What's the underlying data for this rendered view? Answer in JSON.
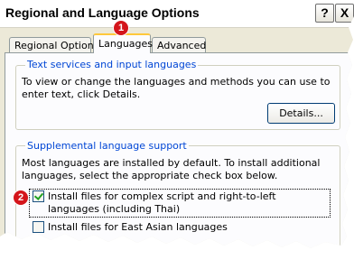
{
  "window": {
    "title": "Regional and Language Options",
    "help_button": "?",
    "close_button": "X"
  },
  "tabs": [
    {
      "label": "Regional Options",
      "selected": false
    },
    {
      "label": "Languages",
      "selected": true
    },
    {
      "label": "Advanced",
      "selected": false
    }
  ],
  "text_services": {
    "legend": "Text services and input languages",
    "description": "To view or change the languages and methods you can use to enter text, click Details.",
    "details_button": "Details..."
  },
  "supplemental": {
    "legend": "Supplemental language support",
    "description": "Most languages are installed by default. To install additional languages, select the appropriate check box below.",
    "checkboxes": [
      {
        "label": "Install files for complex script and right-to-left languages (including Thai)",
        "checked": true
      },
      {
        "label": "Install files for East Asian languages",
        "checked": false
      }
    ]
  },
  "markers": [
    "1",
    "2"
  ],
  "colors": {
    "dialog_face": "#ece9d8",
    "group_label": "#0046d5",
    "tab_highlight": "#ffc83c",
    "marker": "#d4151b"
  }
}
